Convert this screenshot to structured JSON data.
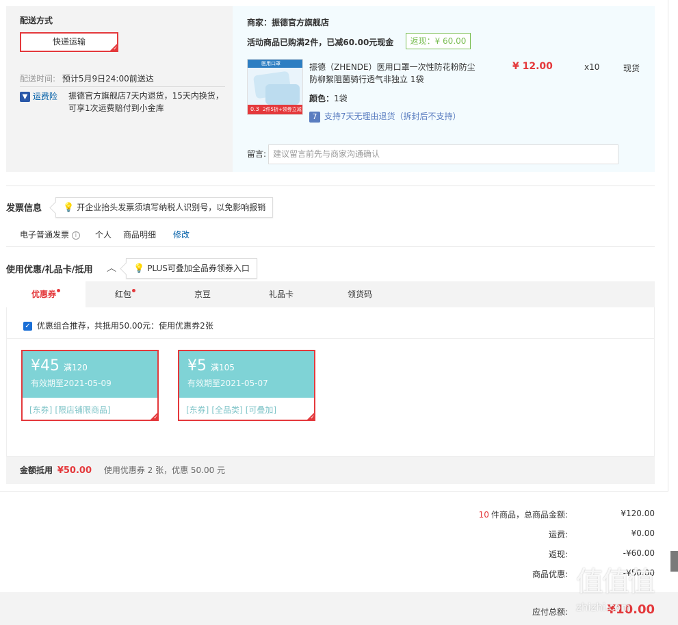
{
  "delivery": {
    "section_label": "配送方式",
    "method_button": "快递运输",
    "time_label": "配送时间:",
    "time_value": "预计5月9日24:00前送达",
    "insurance_link": "运费险",
    "insurance_desc_line1": "振德官方旗舰店7天内退货，15天内换货，",
    "insurance_desc_line2": "可享1次运费赔付到小金库"
  },
  "shop": {
    "merchant_line": "商家：振德官方旗舰店",
    "promo_line": "活动商品已购满2件，已减60.00元现金",
    "cashback_badge": "返现：¥ 60.00",
    "product": {
      "title_line1": "振德（ZHENDE）医用口罩一次性防花粉防尘",
      "title_line2": "防柳絮阻菌骑行透气非独立 1袋",
      "price": "¥ 12.00",
      "qty": "x10",
      "stock": "现货",
      "color_label": "颜色：",
      "color_value": "1袋",
      "return_icon": "7",
      "return_policy": "支持7天无理由退货（拆封后不支持）",
      "img_top_text": "医用口罩",
      "img_bottom_text": "2件5折+领劵立减",
      "img_price": "0.3"
    },
    "note_label": "留言:",
    "note_placeholder": "建议留言前先与商家沟通确认"
  },
  "invoice": {
    "title": "发票信息",
    "tip": "开企业抬头发票须填写纳税人识别号，以免影响报销",
    "type": "电子普通发票",
    "info_icon": "i",
    "person": "个人",
    "detail": "商品明细",
    "edit_link": "修改"
  },
  "discount": {
    "title": "使用优惠/礼品卡/抵用",
    "toggle_icon": "^",
    "tip": "PLUS可叠加全品券领券入口",
    "tabs": [
      {
        "label": "优惠券",
        "dot": true
      },
      {
        "label": "红包",
        "dot": true
      },
      {
        "label": "京豆",
        "dot": false
      },
      {
        "label": "礼品卡",
        "dot": false
      },
      {
        "label": "领货码",
        "dot": false
      }
    ],
    "recommend_text": "优惠组合推荐，共抵用50.00元：使用优惠券2张",
    "coupons": [
      {
        "amount": "¥45",
        "condition": "满120",
        "expiry": "有效期至2021-05-09",
        "tags": [
          "[东券]",
          "[限店铺限商品]"
        ]
      },
      {
        "amount": "¥5",
        "condition": "满105",
        "expiry": "有效期至2021-05-07",
        "tags": [
          "[东券]",
          "[全品类]",
          "[可叠加]"
        ]
      }
    ],
    "summary_label": "金额抵用",
    "summary_amount": "¥50.00",
    "summary_desc": "使用优惠券 2 张，优惠 50.00 元"
  },
  "totals": {
    "count": "10",
    "goods_label": "件商品，总商品金额:",
    "goods_value": "¥120.00",
    "freight_label": "运费:",
    "freight_value": "¥0.00",
    "cashback_label": "返现:",
    "cashback_value": "-¥60.00",
    "discount_label": "商品优惠:",
    "discount_value": "-¥50.00",
    "payable_label": "应付总额:",
    "payable_value": "¥10.00"
  },
  "watermark": {
    "logo": "值",
    "site": "zhizhi.com"
  },
  "colors": {
    "accent": "#e4393c",
    "link": "#005ea7",
    "coupon_teal": "#7fd3d6",
    "cashback_green": "#7abd54"
  }
}
